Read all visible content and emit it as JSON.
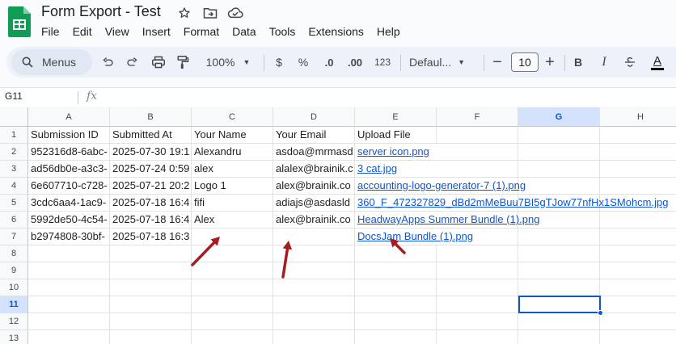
{
  "app": {
    "doc_title": "Form Export - Test",
    "menus": [
      "File",
      "Edit",
      "View",
      "Insert",
      "Format",
      "Data",
      "Tools",
      "Extensions",
      "Help"
    ]
  },
  "toolbar": {
    "search_label": "Menus",
    "zoom": "100%",
    "currency": "$",
    "percent": "%",
    "decrease_decimal": ".0",
    "increase_decimal": ".00",
    "number_format": "123",
    "font_family": "Defaul...",
    "font_size": "10",
    "bold": "B",
    "italic": "I",
    "text_color": "A"
  },
  "formula_bar": {
    "name_box": "G11",
    "fx": "fx",
    "value": ""
  },
  "grid": {
    "columns": [
      "A",
      "B",
      "C",
      "D",
      "E",
      "F",
      "G",
      "H"
    ],
    "selected_column": "G",
    "rows": [
      "1",
      "2",
      "3",
      "4",
      "5",
      "6",
      "7",
      "8",
      "9",
      "10",
      "11",
      "12",
      "13"
    ],
    "selected_row": "11",
    "headers": [
      "Submission ID",
      "Submitted At",
      "Your Name",
      "Your Email",
      "Upload File"
    ],
    "data": [
      [
        "952316d8-6abc-",
        "2025-07-30 19:1",
        "Alexandru",
        "asdoa@mrmasd",
        "server icon.png"
      ],
      [
        "ad56db0e-a3c3-",
        "2025-07-24 0:59",
        "alex",
        "alalex@brainik.c",
        "3 cat.jpg"
      ],
      [
        "6e607710-c728-",
        "2025-07-21 20:2",
        "Logo 1",
        "alex@brainik.co",
        "accounting-logo-generator-7 (1).png"
      ],
      [
        "3cdc6aa4-1ac9-",
        "2025-07-18 16:4",
        "fifi",
        "adiajs@asdasld",
        "360_F_472327829_dBd2mMeBuu7BI5gTJow77nfHx1SMohcm.jpg"
      ],
      [
        "5992de50-4c54-",
        "2025-07-18 16:4",
        "Alex",
        "alex@brainik.co",
        "HeadwayApps Summer Bundle (1).png"
      ],
      [
        "b2974808-30bf-",
        "2025-07-18 16:3",
        "",
        "",
        "DocsJam Bundle (1).png"
      ]
    ]
  },
  "colors": {
    "link": "#1155cc",
    "selection": "#0b57d0",
    "arrow": "#a51d1d",
    "sheets_green": "#0f9d58"
  }
}
